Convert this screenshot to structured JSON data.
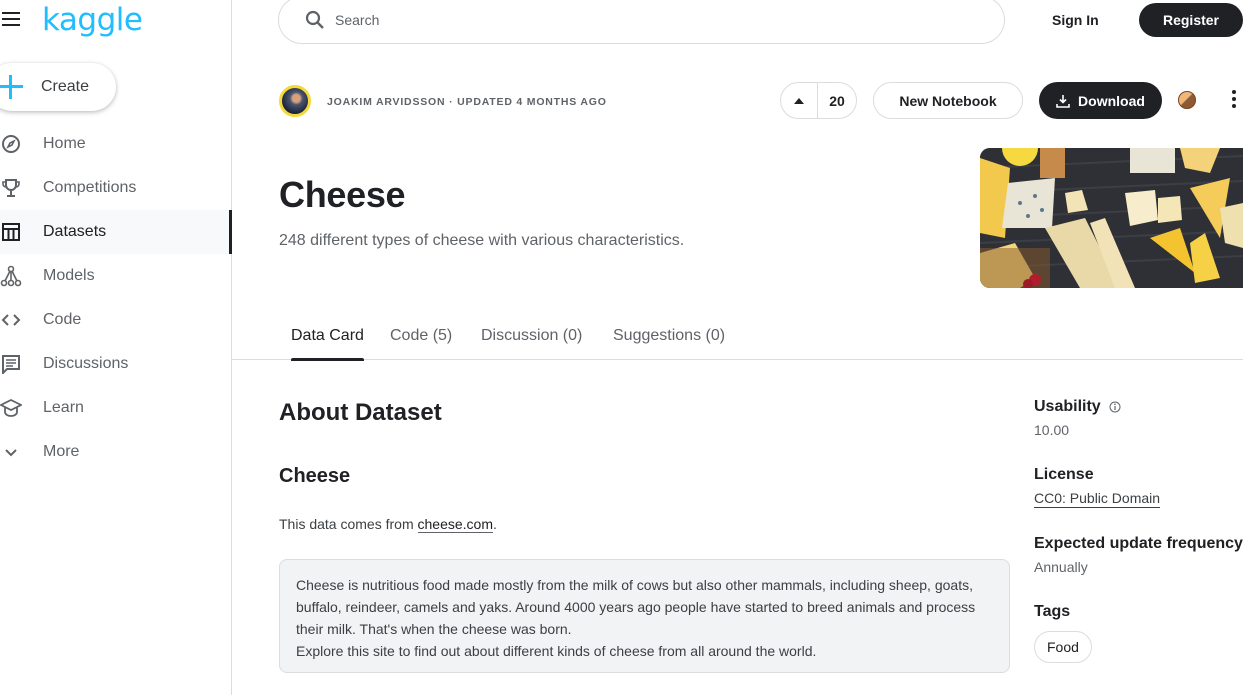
{
  "brand": {
    "logo_text": "kaggle",
    "accent": "#20beff"
  },
  "sidebar": {
    "create_label": "Create",
    "items": [
      {
        "label": "Home",
        "icon": "compass-icon",
        "active": false
      },
      {
        "label": "Competitions",
        "icon": "trophy-icon",
        "active": false
      },
      {
        "label": "Datasets",
        "icon": "table-icon",
        "active": true
      },
      {
        "label": "Models",
        "icon": "models-icon",
        "active": false
      },
      {
        "label": "Code",
        "icon": "code-icon",
        "active": false
      },
      {
        "label": "Discussions",
        "icon": "discussion-icon",
        "active": false
      },
      {
        "label": "Learn",
        "icon": "graduation-cap-icon",
        "active": false
      },
      {
        "label": "More",
        "icon": "chevron-down-icon",
        "active": false
      }
    ]
  },
  "topbar": {
    "search_placeholder": "Search",
    "sign_in": "Sign In",
    "register": "Register"
  },
  "dataset": {
    "byline": "JOAKIM ARVIDSSON · UPDATED 4 MONTHS AGO",
    "votes": "20",
    "new_notebook": "New Notebook",
    "download": "Download",
    "title": "Cheese",
    "subtitle": "248 different types of cheese with various characteristics."
  },
  "tabs": [
    {
      "label": "Data Card",
      "active": true
    },
    {
      "label": "Code (5)",
      "active": false
    },
    {
      "label": "Discussion (0)",
      "active": false
    },
    {
      "label": "Suggestions (0)",
      "active": false
    }
  ],
  "content": {
    "about_heading": "About Dataset",
    "section_heading": "Cheese",
    "source_prefix": "This data comes from ",
    "source_link": "cheese.com",
    "source_suffix": ".",
    "quote_lines": [
      "Cheese is nutritious food made mostly from the milk of cows but also other mammals, including sheep, goats, buffalo, reindeer, camels and yaks. Around 4000 years ago people have started to breed animals and process their milk. That's when the cheese was born.",
      "Explore this site to find out about different kinds of cheese from all around the world."
    ]
  },
  "meta": {
    "usability_label": "Usability",
    "usability_value": "10.00",
    "license_label": "License",
    "license_value": "CC0: Public Domain",
    "frequency_label": "Expected update frequency",
    "frequency_value": "Annually",
    "tags_label": "Tags",
    "tags": [
      "Food"
    ]
  }
}
